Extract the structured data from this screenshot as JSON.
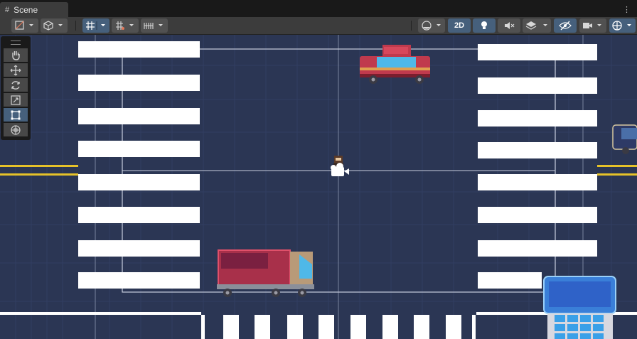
{
  "window": {
    "tab_label": "Scene",
    "tab_icon": "grid-icon",
    "menu_icon": "kebab-menu-icon"
  },
  "toolbar": {
    "left_buttons": [
      {
        "name": "draw-mode-dropdown",
        "icon": "shading-icon",
        "has_dropdown": true
      },
      {
        "name": "gizmo-cube-dropdown",
        "icon": "cube-icon",
        "has_dropdown": true
      },
      {
        "name": "grid-snapping-toggle",
        "icon": "grid-snap-icon",
        "has_dropdown": true,
        "active": true
      },
      {
        "name": "increment-snapping-dropdown",
        "icon": "snap-increment-icon",
        "has_dropdown": true
      },
      {
        "name": "grid-visibility-dropdown",
        "icon": "ruler-grid-icon",
        "has_dropdown": true
      }
    ],
    "right_buttons": [
      {
        "name": "shading-mode-dropdown",
        "icon": "sphere-icon",
        "has_dropdown": true
      },
      {
        "name": "toggle-2d-button",
        "label": "2D",
        "active": true
      },
      {
        "name": "lighting-toggle",
        "icon": "lightbulb-icon",
        "active": true
      },
      {
        "name": "audio-toggle",
        "icon": "audio-mute-icon"
      },
      {
        "name": "effects-dropdown",
        "icon": "layers-icon",
        "has_dropdown": true
      },
      {
        "name": "scene-visibility-toggle",
        "icon": "eye-hidden-icon",
        "active": true
      },
      {
        "name": "camera-dropdown",
        "icon": "camera-icon",
        "has_dropdown": true
      },
      {
        "name": "gizmos-dropdown",
        "icon": "gizmo-globe-icon",
        "has_dropdown": true,
        "active": true
      }
    ],
    "toggle_2d_label": "2D"
  },
  "tool_palette": [
    {
      "name": "hand-tool",
      "icon": "hand-icon"
    },
    {
      "name": "move-tool",
      "icon": "move-arrows-icon"
    },
    {
      "name": "rotate-tool",
      "icon": "rotate-icon"
    },
    {
      "name": "scale-tool",
      "icon": "scale-icon"
    },
    {
      "name": "rect-tool",
      "icon": "rect-transform-icon",
      "active": true
    },
    {
      "name": "transform-tool",
      "icon": "transform-icon"
    }
  ],
  "scene": {
    "colors": {
      "road": "#2b3654",
      "grid_line": "#34406a",
      "stripe": "#ffffff",
      "yellow_line": "#e6c229",
      "camera_frame": "#c8cede",
      "car_red": "#c03a4d",
      "truck_cargo": "#a8304a",
      "truck_cab": "#b89a78",
      "building_blue": "#3a7fd8"
    },
    "objects": [
      {
        "name": "red-car-sprite",
        "type": "car"
      },
      {
        "name": "truck-sprite",
        "type": "truck"
      },
      {
        "name": "character-sprite",
        "type": "character"
      },
      {
        "name": "partial-car-sprite",
        "type": "car"
      },
      {
        "name": "bus-stop-sprite",
        "type": "building"
      }
    ],
    "gizmo": "camera-gizmo-icon"
  }
}
